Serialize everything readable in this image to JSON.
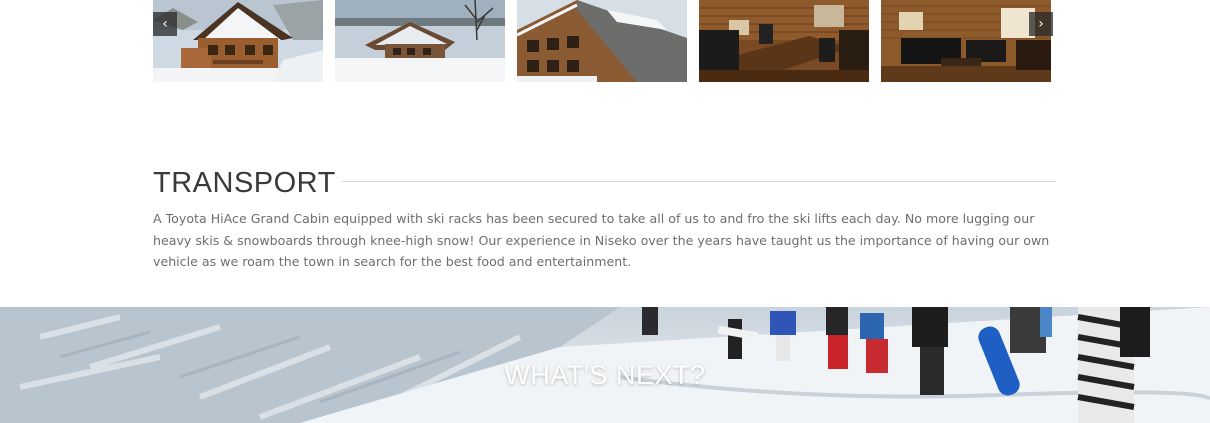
{
  "gallery": {
    "prev_icon": "‹",
    "next_icon": "›",
    "images": [
      {
        "name": "log-cabin-exterior-snow"
      },
      {
        "name": "cabin-in-snowy-field"
      },
      {
        "name": "cabin-roof-snow"
      },
      {
        "name": "dining-room-interior"
      },
      {
        "name": "living-room-interior"
      }
    ]
  },
  "transport": {
    "title": "TRANSPORT",
    "body": "A Toyota HiAce Grand Cabin equipped with ski racks has been secured to take all of us to and fro the ski lifts each day. No more lugging our heavy skis & snowboards through knee-high snow! Our experience in Niseko over the years have taught us the importance of having our own vehicle as we roam the town in search for the best food and entertainment."
  },
  "whats_next": {
    "title": "WHAT'S NEXT?"
  },
  "colors": {
    "heading": "#3a3a3a",
    "body_text": "#6e6e6e",
    "rule": "#d6d6d6",
    "arrow_bg": "#282828"
  }
}
